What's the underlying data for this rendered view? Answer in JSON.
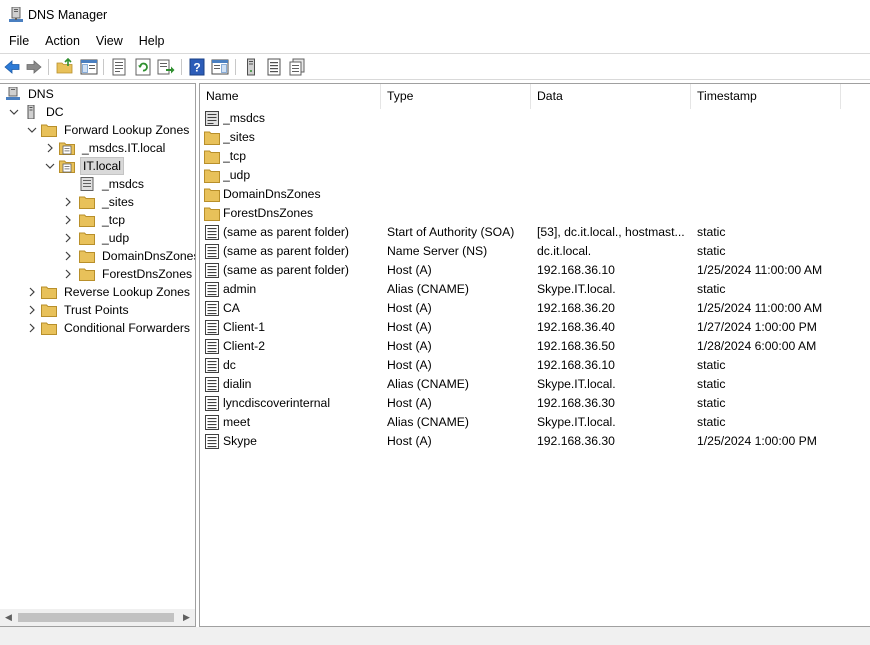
{
  "window": {
    "title": "DNS Manager"
  },
  "menu": [
    "File",
    "Action",
    "View",
    "Help"
  ],
  "toolbar": [
    "back-icon",
    "forward-icon",
    "up-folder-icon",
    "show-hide-console-tree-icon",
    "properties-icon",
    "refresh-icon",
    "export-list-icon",
    "help-icon",
    "show-hide-action-pane-icon",
    "server-icon",
    "record-icon",
    "zone-icon"
  ],
  "tree": {
    "root": "DNS",
    "server": "DC",
    "forward_zones": "Forward Lookup Zones",
    "msdcs_zone": "_msdcs.IT.local",
    "it_local": "IT.local",
    "it_children": [
      "_msdcs",
      "_sites",
      "_tcp",
      "_udp",
      "DomainDnsZones",
      "ForestDnsZones"
    ],
    "reverse_zones": "Reverse Lookup Zones",
    "trust_points": "Trust Points",
    "conditional_forwarders": "Conditional Forwarders"
  },
  "list": {
    "columns": [
      "Name",
      "Type",
      "Data",
      "Timestamp"
    ],
    "rows": [
      {
        "icon": "delegation",
        "name": "_msdcs",
        "type": "",
        "data": "",
        "timestamp": ""
      },
      {
        "icon": "folder",
        "name": "_sites",
        "type": "",
        "data": "",
        "timestamp": ""
      },
      {
        "icon": "folder",
        "name": "_tcp",
        "type": "",
        "data": "",
        "timestamp": ""
      },
      {
        "icon": "folder",
        "name": "_udp",
        "type": "",
        "data": "",
        "timestamp": ""
      },
      {
        "icon": "folder",
        "name": "DomainDnsZones",
        "type": "",
        "data": "",
        "timestamp": ""
      },
      {
        "icon": "folder",
        "name": "ForestDnsZones",
        "type": "",
        "data": "",
        "timestamp": ""
      },
      {
        "icon": "record",
        "name": "(same as parent folder)",
        "type": "Start of Authority (SOA)",
        "data": "[53], dc.it.local., hostmast...",
        "timestamp": "static"
      },
      {
        "icon": "record",
        "name": "(same as parent folder)",
        "type": "Name Server (NS)",
        "data": "dc.it.local.",
        "timestamp": "static"
      },
      {
        "icon": "record",
        "name": "(same as parent folder)",
        "type": "Host (A)",
        "data": "192.168.36.10",
        "timestamp": "1/25/2024 11:00:00 AM"
      },
      {
        "icon": "record",
        "name": "admin",
        "type": "Alias (CNAME)",
        "data": "Skype.IT.local.",
        "timestamp": "static"
      },
      {
        "icon": "record",
        "name": "CA",
        "type": "Host (A)",
        "data": "192.168.36.20",
        "timestamp": "1/25/2024 11:00:00 AM"
      },
      {
        "icon": "record",
        "name": "Client-1",
        "type": "Host (A)",
        "data": "192.168.36.40",
        "timestamp": "1/27/2024 1:00:00 PM"
      },
      {
        "icon": "record",
        "name": "Client-2",
        "type": "Host (A)",
        "data": "192.168.36.50",
        "timestamp": "1/28/2024 6:00:00 AM"
      },
      {
        "icon": "record",
        "name": "dc",
        "type": "Host (A)",
        "data": "192.168.36.10",
        "timestamp": "static"
      },
      {
        "icon": "record",
        "name": "dialin",
        "type": "Alias (CNAME)",
        "data": "Skype.IT.local.",
        "timestamp": "static"
      },
      {
        "icon": "record",
        "name": "lyncdiscoverinternal",
        "type": "Host (A)",
        "data": "192.168.36.30",
        "timestamp": "static"
      },
      {
        "icon": "record",
        "name": "meet",
        "type": "Alias (CNAME)",
        "data": "Skype.IT.local.",
        "timestamp": "static"
      },
      {
        "icon": "record",
        "name": "Skype",
        "type": "Host (A)",
        "data": "192.168.36.30",
        "timestamp": "1/25/2024 1:00:00 PM"
      }
    ]
  },
  "colors": {
    "folder": "#e8c15a",
    "folder_dark": "#c9a035",
    "selected": "#d9d9d9",
    "border": "#a0a0a0",
    "nav_arrow": "#2c7ad6"
  }
}
